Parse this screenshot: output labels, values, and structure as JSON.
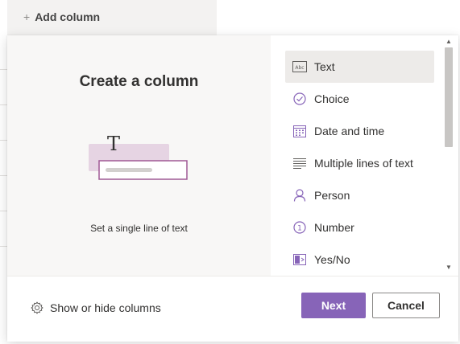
{
  "background": {
    "add_column_label": "Add column",
    "add_column_icon": "plus-icon"
  },
  "dialog": {
    "title": "Create a column",
    "illustration_glyph": "T",
    "description": "Set a single line of text",
    "column_types": [
      {
        "label": "Text",
        "icon": "text-box-icon",
        "icon_text": "Abc",
        "selected": true
      },
      {
        "label": "Choice",
        "icon": "checkmark-circle-icon",
        "selected": false
      },
      {
        "label": "Date and time",
        "icon": "calendar-icon",
        "selected": false
      },
      {
        "label": "Multiple lines of text",
        "icon": "multiline-text-icon",
        "selected": false
      },
      {
        "label": "Person",
        "icon": "person-icon",
        "selected": false
      },
      {
        "label": "Number",
        "icon": "number-circle-icon",
        "icon_text": "1",
        "selected": false
      },
      {
        "label": "Yes/No",
        "icon": "toggle-icon",
        "selected": false
      }
    ],
    "footer": {
      "show_hide_label": "Show or hide columns",
      "next_label": "Next",
      "cancel_label": "Cancel"
    }
  },
  "colors": {
    "accent": "#8764b8",
    "selected_bg": "#edebe9",
    "pane_bg": "#f8f7f6"
  }
}
